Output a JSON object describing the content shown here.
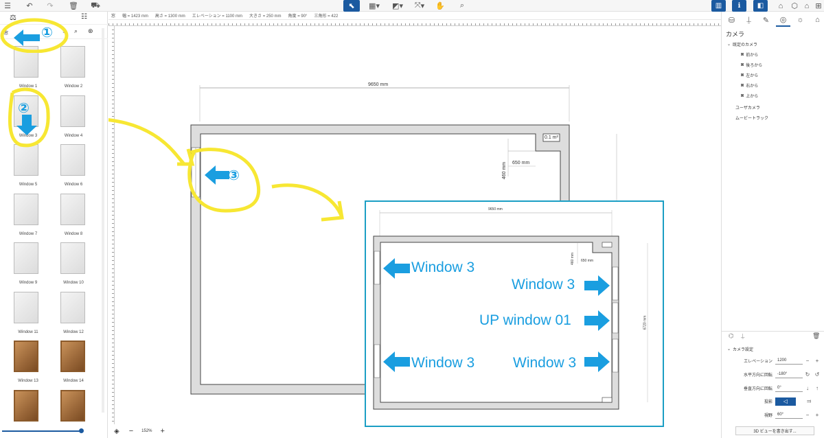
{
  "toolbar": {
    "items": [
      "menu",
      "undo",
      "redo",
      "delete",
      "cart",
      "select",
      "create-walls",
      "create-rooms",
      "dimensions",
      "pan",
      "search"
    ]
  },
  "info_bar": {
    "items": [
      "窓",
      "幅 = 1423 mm",
      "高さ = 1300 mm",
      "エレベーション = 1100 mm",
      "大きさ = 250 mm",
      "角度 = 90°",
      "三角形 = 422"
    ]
  },
  "catalog": {
    "category": "窓",
    "items": [
      {
        "label": "Window 1",
        "kind": "white"
      },
      {
        "label": "Window 2",
        "kind": "white"
      },
      {
        "label": "Window 3",
        "kind": "white"
      },
      {
        "label": "Window 4",
        "kind": "white"
      },
      {
        "label": "Window 5",
        "kind": "white"
      },
      {
        "label": "Window 6",
        "kind": "white"
      },
      {
        "label": "Window 7",
        "kind": "white"
      },
      {
        "label": "Window 8",
        "kind": "white"
      },
      {
        "label": "Window 9",
        "kind": "white"
      },
      {
        "label": "Window 10",
        "kind": "white"
      },
      {
        "label": "Window 11",
        "kind": "white"
      },
      {
        "label": "Window 12",
        "kind": "white"
      },
      {
        "label": "Window 13",
        "kind": "wood"
      },
      {
        "label": "Window 14",
        "kind": "wood"
      },
      {
        "label": "",
        "kind": "wood"
      },
      {
        "label": "",
        "kind": "wood"
      }
    ]
  },
  "plan": {
    "width_dim": "9650 mm",
    "dim_650": "650 mm",
    "dim_460": "460 mm",
    "area_label": "0.1 m²",
    "zoom": "152%"
  },
  "inset": {
    "width_dim": "9650 mm",
    "dim_650": "650 mm",
    "dim_460": "460 mm",
    "right_dim": "6720 mm",
    "labels": [
      "Window 3",
      "Window 3",
      "UP window 01",
      "Window 3",
      "Window 3"
    ]
  },
  "annotations": {
    "num1": "①",
    "num2": "②",
    "num3": "③",
    "highlight_color": "#f7e733",
    "arrow_color": "#1a9ee0"
  },
  "right_panel": {
    "title": "カメラ",
    "tree_root": "既定のカメラ",
    "cameras": [
      "前から",
      "後ろから",
      "左から",
      "右から",
      "上から"
    ],
    "user_camera": "ユーザカメラ",
    "movie_track": "ムービートラック",
    "settings_title": "カメラ設定",
    "elevation_label": "エレベーション",
    "elevation_value": "1200",
    "hrot_label": "水平方向に回転",
    "hrot_value": "-180°",
    "vrot_label": "垂直方向に回転",
    "vrot_value": "0°",
    "projection_label": "投影",
    "fov_label": "視野",
    "fov_value": "60°",
    "export_label": "3D ビューを書き出す..."
  },
  "accent_color": "#1b5aa0"
}
